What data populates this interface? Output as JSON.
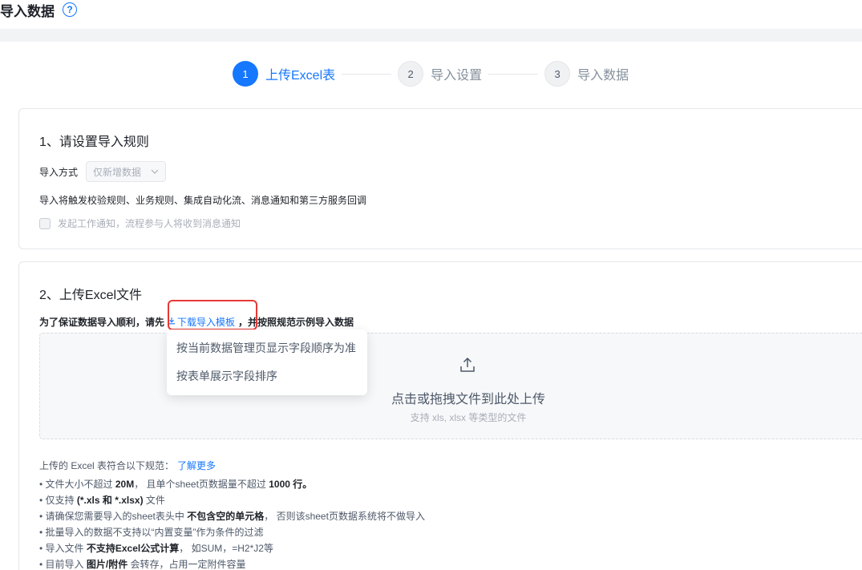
{
  "header": {
    "title": "导入数据",
    "help_glyph": "?"
  },
  "steps": [
    {
      "number": "1",
      "label": "上传Excel表"
    },
    {
      "number": "2",
      "label": "导入设置"
    },
    {
      "number": "3",
      "label": "导入数据"
    }
  ],
  "rules_section": {
    "title": "1、请设置导入规则",
    "mode_label": "导入方式",
    "mode_value": "仅新增数据",
    "trigger_note": "导入将触发校验规则、业务规则、集成自动化流、消息通知和第三方服务回调",
    "notify_checkbox_label": "发起工作通知，流程参与人将收到消息通知"
  },
  "upload_section": {
    "title": "2、上传Excel文件",
    "tip_prefix": "为了保证数据导入顺利，请先",
    "download_link": "下载导入模板",
    "tip_suffix": "，并按照规范示例导入数据",
    "upload_main": "点击或拖拽文件到此处上传",
    "upload_sub": "支持 xls, xlsx 等类型的文件",
    "dropdown_items": [
      "按当前数据管理页显示字段顺序为准",
      "按表单展示字段排序"
    ],
    "rules_intro": "上传的 Excel 表符合以下规范：",
    "learn_more": "了解更多",
    "rule1_a": "• 文件大小不超过 ",
    "rule1_b": "20M",
    "rule1_c": "， 且单个sheet页数据量不超过 ",
    "rule1_d": "1000 行。",
    "rule2_a": "• 仅支持 ",
    "rule2_b": "(*.xls 和 *.xlsx)",
    "rule2_c": " 文件",
    "rule3_a": "• 请确保您需要导入的sheet表头中 ",
    "rule3_b": "不包含空的单元格",
    "rule3_c": "， 否则该sheet页数据系统将不做导入",
    "rule4": "• 批量导入的数据不支持以“内置变量”作为条件的过滤",
    "rule5_a": "• 导入文件 ",
    "rule5_b": "不支持Excel公式计算",
    "rule5_c": "， 如SUM，=H2*J2等",
    "rule6_a": "• 目前导入 ",
    "rule6_b": "图片/附件",
    "rule6_c": " 会转存，占用一定附件容量"
  },
  "colors": {
    "primary": "#1677ff",
    "highlight": "#e53935"
  }
}
